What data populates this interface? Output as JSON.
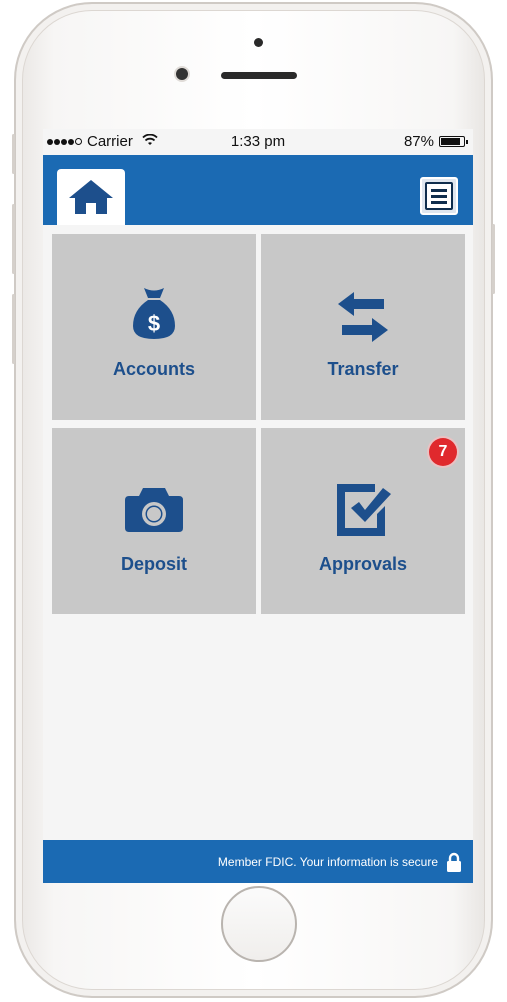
{
  "status_bar": {
    "carrier": "Carrier",
    "time": "1:33 pm",
    "battery": "87%",
    "battery_level": 0.87,
    "signal_bars_filled": 4,
    "signal_bars_total": 5
  },
  "header": {
    "home_icon": "house-icon",
    "menu_icon": "hamburger-menu-icon"
  },
  "tiles": [
    {
      "label": "Accounts",
      "icon": "money-bag-icon"
    },
    {
      "label": "Transfer",
      "icon": "swap-arrows-icon"
    },
    {
      "label": "Deposit",
      "icon": "camera-icon"
    },
    {
      "label": "Approvals",
      "icon": "checkbox-icon",
      "badge": "7"
    }
  ],
  "footer": {
    "text": "Member FDIC. Your information is secure",
    "icon": "lock-icon"
  },
  "colors": {
    "brand_blue": "#1b6ab3",
    "icon_blue": "#1d4f8c",
    "tile_gray": "#c8c8c8",
    "badge_red": "#e0292d"
  }
}
